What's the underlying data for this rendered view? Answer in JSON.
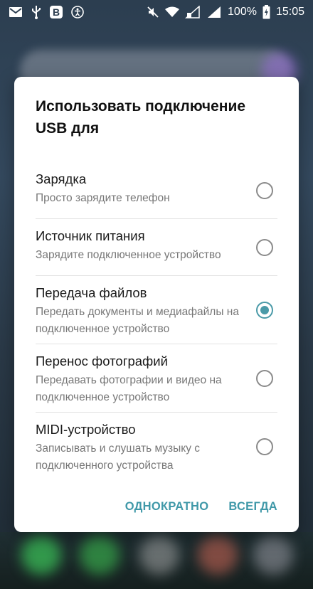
{
  "status_bar": {
    "battery": "100%",
    "time": "15:05",
    "left_icons": [
      "gmail-icon",
      "usb-icon",
      "vk-icon",
      "accessibility-icon"
    ],
    "vk_letter": "В",
    "right_icons": [
      "mute-icon",
      "wifi-icon",
      "signal-sim1-icon",
      "signal-sim2-icon",
      "battery-charging-icon"
    ]
  },
  "dialog": {
    "title": "Использовать подключение USB для",
    "options": [
      {
        "label": "Зарядка",
        "description": "Просто зарядите телефон",
        "selected": false
      },
      {
        "label": "Источник питания",
        "description": "Зарядите подключенное устройство",
        "selected": false
      },
      {
        "label": "Передача файлов",
        "description": "Передать документы и медиафайлы на подключенное устройство",
        "selected": true
      },
      {
        "label": "Перенос фотографий",
        "description": "Передавать фотографии и видео на подключенное устройство",
        "selected": false
      },
      {
        "label": "MIDI-устройство",
        "description": "Записывать и слушать музыку с подключенного устройства",
        "selected": false
      }
    ],
    "actions": {
      "once": "ОДНОКРАТНО",
      "always": "ВСЕГДА"
    }
  },
  "colors": {
    "accent": "#3f98a8",
    "radio_checked": "#4a9aa8"
  }
}
